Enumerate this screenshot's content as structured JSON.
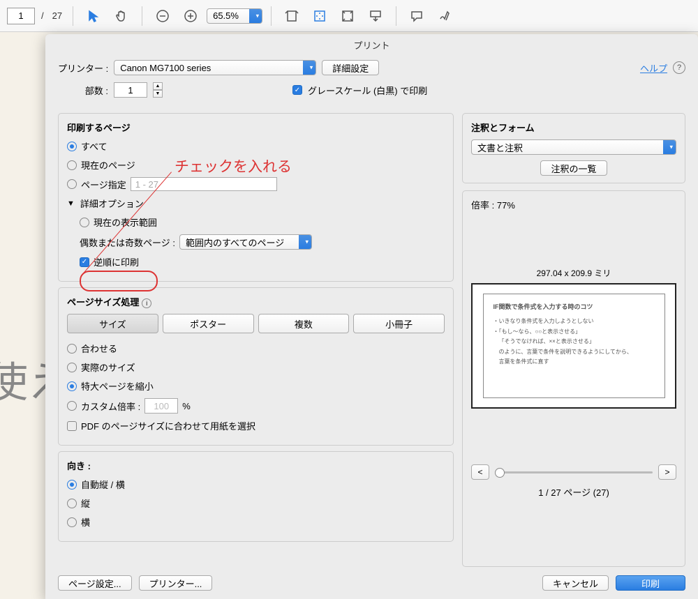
{
  "toolbar": {
    "current_page": "1",
    "total_pages": "27",
    "zoom": "65.5%"
  },
  "bg_text": "使え",
  "dialog": {
    "title": "プリント",
    "printer_label": "プリンター :",
    "printer": "Canon MG7100 series",
    "copies_label": "部数 :",
    "copies": "1",
    "advanced_btn": "詳細設定",
    "grayscale": "グレースケール (白黒) で印刷",
    "help": "ヘルプ"
  },
  "pages": {
    "title": "印刷するページ",
    "all": "すべて",
    "current": "現在のページ",
    "range_label": "ページ指定",
    "range_value": "1 - 27",
    "adv": "詳細オプション",
    "viewport": "現在の表示範囲",
    "oddeven_label": "偶数または奇数ページ :",
    "oddeven_value": "範囲内のすべてのページ",
    "reverse": "逆順に印刷"
  },
  "size": {
    "title": "ページサイズ処理",
    "tabs": [
      "サイズ",
      "ポスター",
      "複数",
      "小冊子"
    ],
    "fit": "合わせる",
    "actual": "実際のサイズ",
    "shrink": "特大ページを縮小",
    "custom": "カスタム倍率 :",
    "custom_val": "100",
    "percent": "%",
    "paper": "PDF のページサイズに合わせて用紙を選択"
  },
  "orient": {
    "title": "向き :",
    "auto": "自動縦 / 横",
    "portrait": "縦",
    "landscape": "横"
  },
  "annot": {
    "title": "注釈とフォーム",
    "select": "文書と注釈",
    "list_btn": "注釈の一覧"
  },
  "preview": {
    "scale_label": "倍率 :",
    "scale": "77%",
    "dims": "297.04 x 209.9 ミリ",
    "page_info": "1 / 27 ページ (27)",
    "content_title": "IF関数で条件式を入力する時のコツ",
    "content_lines": [
      "・いきなり条件式を入力しようとしない",
      "・「もし〜なら、○○と表示させる」",
      "「そうでなければ、××と表示させる」",
      "のように、言葉で条件を説明できるようにしてから、",
      "言葉を条件式に直す"
    ]
  },
  "footer": {
    "page_setup": "ページ設定...",
    "printer_btn": "プリンター...",
    "cancel": "キャンセル",
    "print": "印刷"
  },
  "callout": "チェックを入れる"
}
